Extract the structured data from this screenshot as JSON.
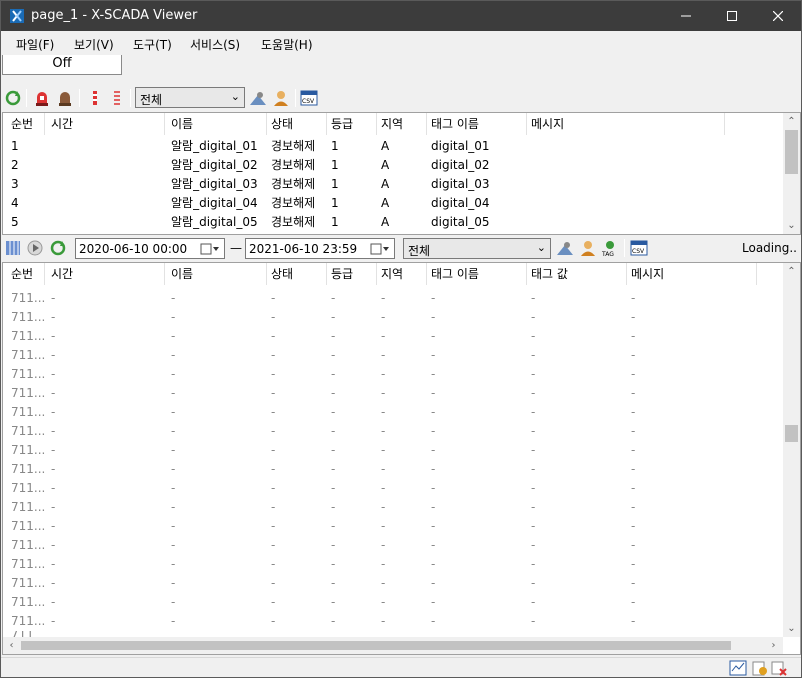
{
  "window": {
    "title": "page_1 - X-SCADA Viewer"
  },
  "menu": {
    "items": [
      "파일(F)",
      "보기(V)",
      "도구(T)",
      "서비스(S)",
      "도움말(H)"
    ]
  },
  "status_box": {
    "value": "Off"
  },
  "alarm_toolbar": {
    "filter_value": "전체"
  },
  "alarm_grid": {
    "columns": [
      "순번",
      "시간",
      "이름",
      "상태",
      "등급",
      "지역",
      "태그 이름",
      "메시지"
    ],
    "rows": [
      [
        "1",
        "",
        "알람_digital_01",
        "경보해제",
        "1",
        "A",
        "digital_01",
        ""
      ],
      [
        "2",
        "",
        "알람_digital_02",
        "경보해제",
        "1",
        "A",
        "digital_02",
        ""
      ],
      [
        "3",
        "",
        "알람_digital_03",
        "경보해제",
        "1",
        "A",
        "digital_03",
        ""
      ],
      [
        "4",
        "",
        "알람_digital_04",
        "경보해제",
        "1",
        "A",
        "digital_04",
        ""
      ],
      [
        "5",
        "",
        "알람_digital_05",
        "경보해제",
        "1",
        "A",
        "digital_05",
        ""
      ]
    ]
  },
  "history_toolbar": {
    "start": "2020-06-10 00:00",
    "dash": "—",
    "end": "2021-06-10 23:59",
    "filter_value": "전체",
    "loading": "Loading.."
  },
  "history_grid": {
    "columns": [
      "순번",
      "시간",
      "이름",
      "상태",
      "등급",
      "지역",
      "태그 이름",
      "태그 값",
      "메시지"
    ],
    "row_prefix": "711...",
    "placeholder": "-",
    "row_count": 18,
    "partial_row": "711"
  },
  "colors": {
    "titlebar": "#3c3c3c",
    "grid_bg": "#ffffff",
    "window_bg": "#f0f0f0",
    "history_text": "#888888"
  }
}
